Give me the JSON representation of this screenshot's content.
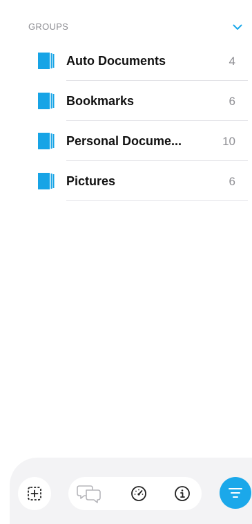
{
  "groups_section": {
    "title": "GROUPS"
  },
  "groups": [
    {
      "name": "Auto Documents",
      "count": "4"
    },
    {
      "name": "Bookmarks",
      "count": "6"
    },
    {
      "name": "Personal Docume...",
      "count": "10"
    },
    {
      "name": "Pictures",
      "count": "6"
    }
  ],
  "toolbar": {
    "icons": [
      "add-group-icon",
      "chat-icon",
      "gauge-icon",
      "info-icon",
      "filter-icon"
    ]
  },
  "colors": {
    "accent": "#1ba8ea",
    "folder": "#17a4e6",
    "secondary_text": "#8e8e93",
    "primary_text": "#111111",
    "divider": "#e2e2e6",
    "toolbar_bg": "#f3f3f5"
  }
}
